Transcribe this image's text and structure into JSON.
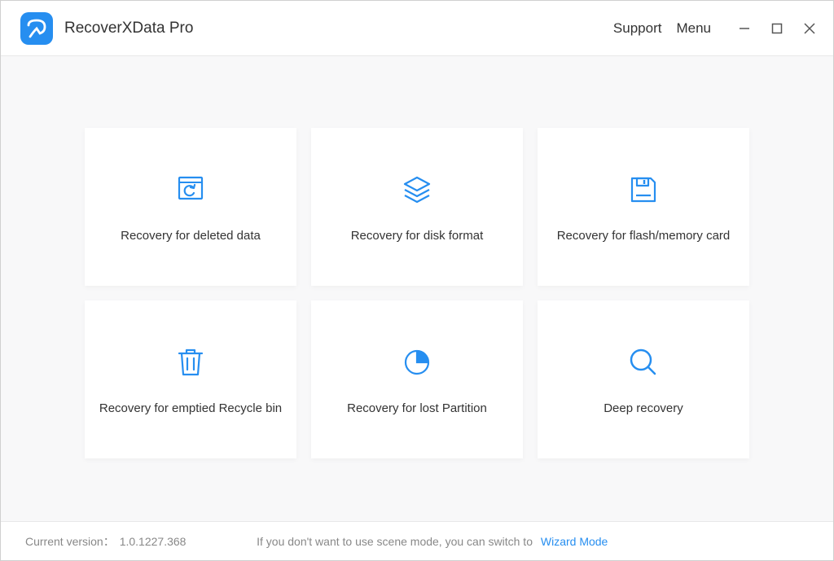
{
  "header": {
    "title": "RecoverXData Pro",
    "support": "Support",
    "menu": "Menu"
  },
  "tiles": [
    {
      "label": "Recovery for deleted data",
      "icon": "restore-file-icon"
    },
    {
      "label": "Recovery for disk format",
      "icon": "layers-icon"
    },
    {
      "label": "Recovery for flash/memory card",
      "icon": "save-disk-icon"
    },
    {
      "label": "Recovery for emptied Recycle bin",
      "icon": "trash-icon"
    },
    {
      "label": "Recovery for lost Partition",
      "icon": "pie-chart-icon"
    },
    {
      "label": "Deep recovery",
      "icon": "magnifier-icon"
    }
  ],
  "footer": {
    "version_label": "Current version：",
    "version": "1.0.1227.368",
    "switch_text": "If you don't want to use scene mode, you can switch to",
    "wizard_link": "Wizard Mode"
  }
}
